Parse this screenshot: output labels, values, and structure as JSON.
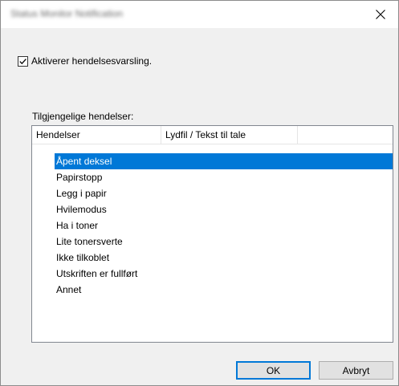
{
  "window": {
    "title": "Status Monitor Notification",
    "close_icon": "close-icon"
  },
  "notification": {
    "checkbox_label": "Aktiverer hendelsesvarsling.",
    "checked": true
  },
  "events": {
    "group_label": "Tilgjengelige hendelser:",
    "columns": [
      "Hendelser",
      "Lydfil / Tekst til tale"
    ],
    "rows": [
      {
        "event": "Åpent deksel",
        "selected": true
      },
      {
        "event": "Papirstopp",
        "selected": false
      },
      {
        "event": "Legg i papir",
        "selected": false
      },
      {
        "event": "Hvilemodus",
        "selected": false
      },
      {
        "event": "Ha i toner",
        "selected": false
      },
      {
        "event": "Lite tonersverte",
        "selected": false
      },
      {
        "event": "Ikke tilkoblet",
        "selected": false
      },
      {
        "event": "Utskriften er fullført",
        "selected": false
      },
      {
        "event": "Annet",
        "selected": false
      }
    ]
  },
  "buttons": {
    "ok": "OK",
    "cancel": "Avbryt"
  },
  "colors": {
    "selection": "#0078d7",
    "dialog_bg": "#f0f0f0"
  }
}
